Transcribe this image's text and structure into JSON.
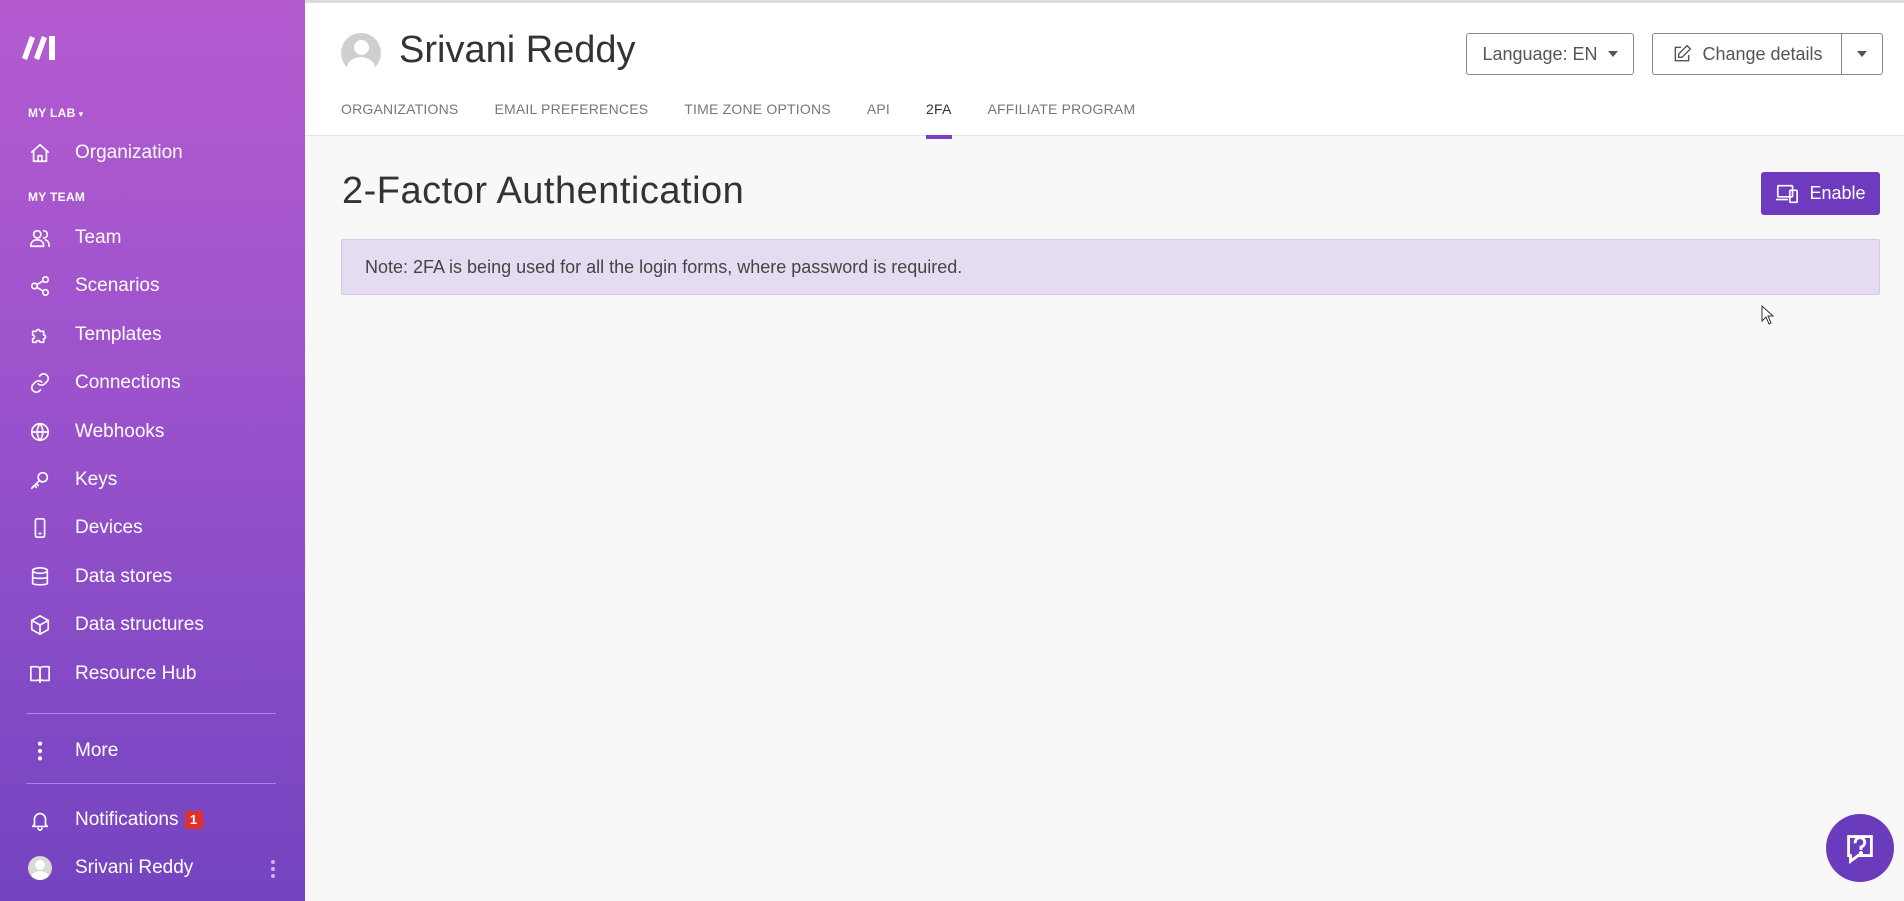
{
  "sidebar": {
    "sections": {
      "my_lab": "MY LAB",
      "my_team": "MY TEAM"
    },
    "items": [
      {
        "label": "Organization",
        "icon": "home-icon"
      },
      {
        "label": "Team",
        "icon": "users-icon"
      },
      {
        "label": "Scenarios",
        "icon": "share-icon"
      },
      {
        "label": "Templates",
        "icon": "puzzle-icon"
      },
      {
        "label": "Connections",
        "icon": "link-icon"
      },
      {
        "label": "Webhooks",
        "icon": "globe-icon"
      },
      {
        "label": "Keys",
        "icon": "key-icon"
      },
      {
        "label": "Devices",
        "icon": "phone-icon"
      },
      {
        "label": "Data stores",
        "icon": "database-icon"
      },
      {
        "label": "Data structures",
        "icon": "cube-icon"
      },
      {
        "label": "Resource Hub",
        "icon": "book-icon"
      }
    ],
    "more_label": "More",
    "notifications_label": "Notifications",
    "notifications_count": "1",
    "user_name": "Srivani Reddy"
  },
  "header": {
    "user_name": "Srivani Reddy",
    "tabs": [
      {
        "label": "ORGANIZATIONS"
      },
      {
        "label": "EMAIL PREFERENCES"
      },
      {
        "label": "TIME ZONE OPTIONS"
      },
      {
        "label": "API"
      },
      {
        "label": "2FA"
      },
      {
        "label": "AFFILIATE PROGRAM"
      }
    ],
    "language_label": "Language: EN",
    "change_details_label": "Change details"
  },
  "main": {
    "title": "2-Factor Authentication",
    "enable_label": "Enable",
    "note": "Note: 2FA is being used for all the login forms, where password is required."
  },
  "colors": {
    "accent": "#6e3bbf",
    "note_bg": "#e5dcf2",
    "badge": "#e0302c"
  }
}
